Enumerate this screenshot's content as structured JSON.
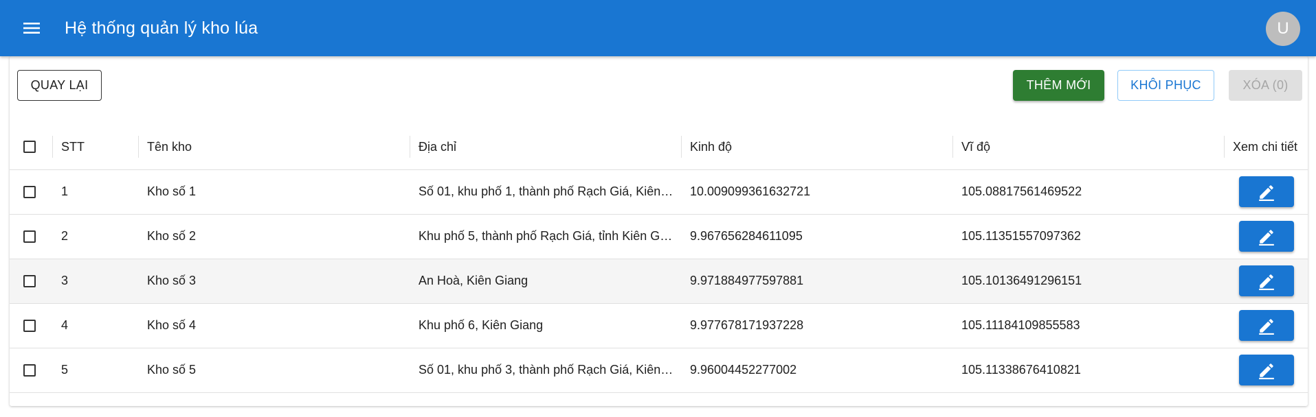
{
  "appbar": {
    "title": "Hệ thống quản lý kho lúa",
    "avatar_letter": "U",
    "color": "#1976d2"
  },
  "toolbar": {
    "back_label": "QUAY LẠI",
    "add_label": "THÊM MỚI",
    "restore_label": "KHÔI PHỤC",
    "delete_label": "XÓA (0)"
  },
  "table": {
    "headers": {
      "stt": "STT",
      "name": "Tên kho",
      "address": "Địa chỉ",
      "longitude": "Kinh độ",
      "latitude": "Vĩ độ",
      "detail": "Xem chi tiết"
    },
    "rows": [
      {
        "stt": "1",
        "name": "Kho số 1",
        "address": "Số 01, khu phố 1, thành phố Rạch Giá, Kiên…",
        "longitude": "10.009099361632721",
        "latitude": "105.08817561469522"
      },
      {
        "stt": "2",
        "name": "Kho số 2",
        "address": "Khu phố 5, thành phố Rạch Giá, tỉnh Kiên G…",
        "longitude": "9.967656284611095",
        "latitude": "105.11351557097362"
      },
      {
        "stt": "3",
        "name": "Kho số 3",
        "address": "An Hoà, Kiên Giang",
        "longitude": "9.971884977597881",
        "latitude": "105.10136491296151"
      },
      {
        "stt": "4",
        "name": "Kho số 4",
        "address": "Khu phố 6, Kiên Giang",
        "longitude": "9.977678171937228",
        "latitude": "105.11184109855583"
      },
      {
        "stt": "5",
        "name": "Kho số 5",
        "address": "Số 01, khu phố 3, thành phố Rạch Giá, Kiên…",
        "longitude": "9.96004452277002",
        "latitude": "105.11338676410821"
      }
    ]
  },
  "icons": {
    "menu": "menu-icon",
    "edit": "pencil-icon"
  }
}
